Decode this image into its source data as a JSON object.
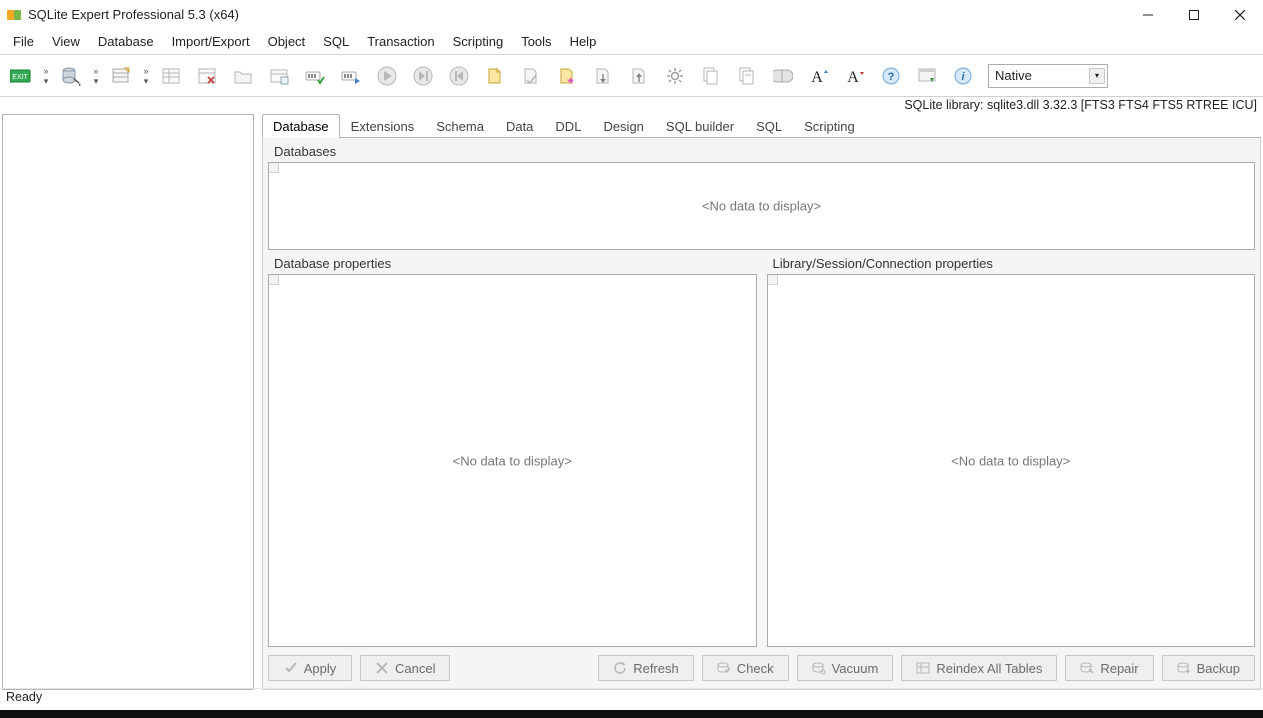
{
  "window": {
    "title": "SQLite Expert Professional 5.3 (x64)"
  },
  "menu": {
    "items": [
      "File",
      "View",
      "Database",
      "Import/Export",
      "Object",
      "SQL",
      "Transaction",
      "Scripting",
      "Tools",
      "Help"
    ]
  },
  "toolbar": {
    "combo_value": "Native"
  },
  "infobar": {
    "text": "SQLite library: sqlite3.dll 3.32.3 [FTS3 FTS4 FTS5 RTREE ICU]"
  },
  "tabs": {
    "items": [
      "Database",
      "Extensions",
      "Schema",
      "Data",
      "DDL",
      "Design",
      "SQL builder",
      "SQL",
      "Scripting"
    ],
    "active": 0
  },
  "groups": {
    "databases": {
      "header": "Databases",
      "empty_text": "<No data to display>"
    },
    "dbprops": {
      "header": "Database properties",
      "empty_text": "<No data to display>"
    },
    "libprops": {
      "header": "Library/Session/Connection properties",
      "empty_text": "<No data to display>"
    }
  },
  "buttons": {
    "apply": "Apply",
    "cancel": "Cancel",
    "refresh": "Refresh",
    "check": "Check",
    "vacuum": "Vacuum",
    "reindex": "Reindex All Tables",
    "repair": "Repair",
    "backup": "Backup"
  },
  "status": {
    "text": "Ready"
  }
}
